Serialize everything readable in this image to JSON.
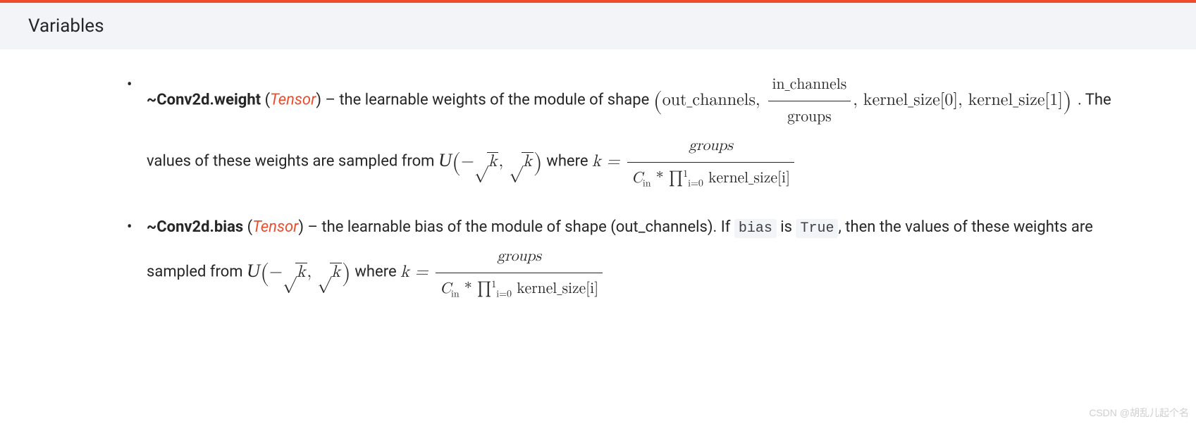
{
  "header": {
    "title": "Variables"
  },
  "items": [
    {
      "name": "~Conv2d.weight",
      "type": "Tensor",
      "desc1": " – the learnable weights of the module of shape ",
      "shape_parts": {
        "out": "out_channels",
        "frac_num": "in_channels",
        "frac_den": "groups",
        "ks0": "kernel_size[0]",
        "ks1": "kernel_size[1]"
      },
      "desc2": ". The values of these weights are sampled from ",
      "dist_prefix": "U",
      "where_text": " where ",
      "k_eq": "k =",
      "kfrac_num": "groups",
      "kfrac_den_cin": "C",
      "kfrac_den_in": "in",
      "kfrac_den_star": " * ",
      "kfrac_den_prod": "∏",
      "kfrac_den_lim_lo": "i=0",
      "kfrac_den_lim_hi": "1",
      "kfrac_den_ks": " kernel_size[i]"
    },
    {
      "name": "~Conv2d.bias",
      "type": "Tensor",
      "desc1": " – the learnable bias of the module of shape (out_channels). If ",
      "code1": "bias",
      "desc2": " is ",
      "code2": "True",
      "desc3": ", then the values of these weights are sampled from ",
      "dist_prefix": "U",
      "where_text": " where ",
      "k_eq": "k =",
      "kfrac_num": "groups",
      "kfrac_den_cin": "C",
      "kfrac_den_in": "in",
      "kfrac_den_star": " * ",
      "kfrac_den_prod": "∏",
      "kfrac_den_lim_lo": "i=0",
      "kfrac_den_lim_hi": "1",
      "kfrac_den_ks": " kernel_size[i]"
    }
  ],
  "watermark": "CSDN @胡乱儿起个名"
}
